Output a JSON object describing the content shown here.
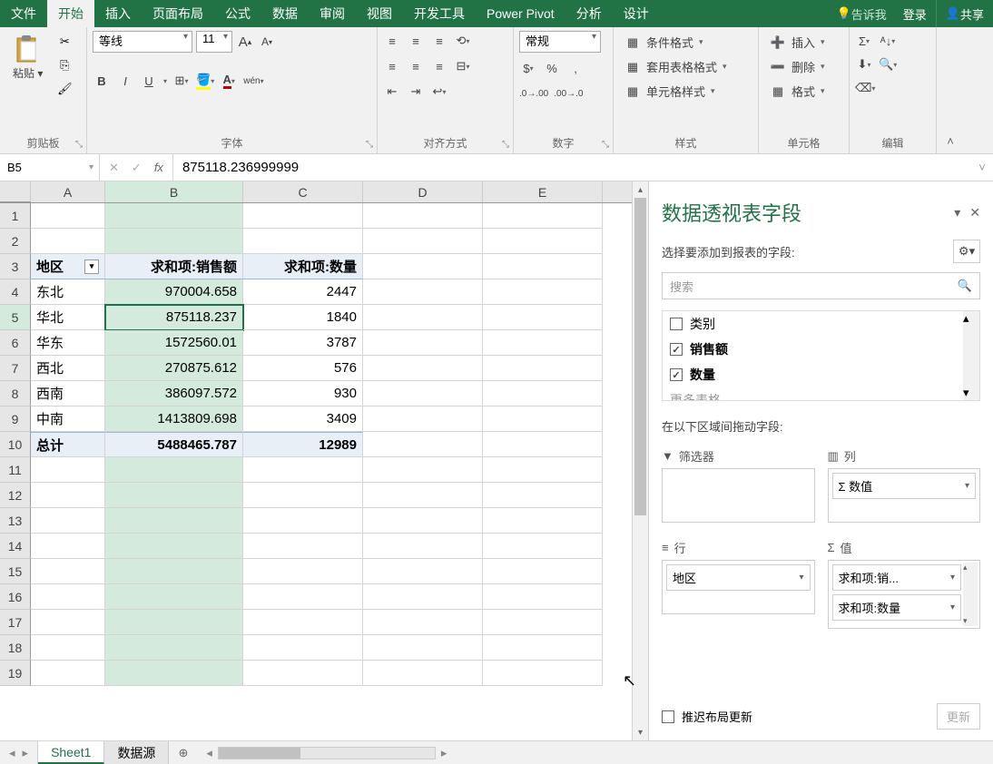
{
  "tabs": {
    "file": "文件",
    "home": "开始",
    "insert": "插入",
    "layout": "页面布局",
    "formulas": "公式",
    "data": "数据",
    "review": "审阅",
    "view": "视图",
    "dev": "开发工具",
    "pivot": "Power Pivot",
    "analyze": "分析",
    "design": "设计",
    "tellme": "告诉我",
    "login": "登录",
    "share": "共享"
  },
  "ribbon": {
    "clipboard": {
      "paste": "粘贴",
      "label": "剪贴板"
    },
    "font": {
      "name": "等线",
      "size": "11",
      "label": "字体",
      "pinyin": "wén"
    },
    "align": {
      "label": "对齐方式"
    },
    "number": {
      "format": "常规",
      "label": "数字"
    },
    "styles": {
      "cond": "条件格式",
      "table": "套用表格格式",
      "cell": "单元格样式",
      "label": "样式"
    },
    "cells": {
      "insert": "插入",
      "delete": "删除",
      "format": "格式",
      "label": "单元格"
    },
    "editing": {
      "label": "编辑"
    }
  },
  "formula_bar": {
    "cell_ref": "B5",
    "value": "875118.236999999"
  },
  "grid": {
    "cols": [
      "A",
      "B",
      "C",
      "D",
      "E"
    ],
    "headers": [
      "地区",
      "求和项:销售额",
      "求和项:数量"
    ],
    "rows": [
      {
        "region": "东北",
        "sales": "970004.658",
        "qty": "2447"
      },
      {
        "region": "华北",
        "sales": "875118.237",
        "qty": "1840"
      },
      {
        "region": "华东",
        "sales": "1572560.01",
        "qty": "3787"
      },
      {
        "region": "西北",
        "sales": "270875.612",
        "qty": "576"
      },
      {
        "region": "西南",
        "sales": "386097.572",
        "qty": "930"
      },
      {
        "region": "中南",
        "sales": "1413809.698",
        "qty": "3409"
      }
    ],
    "total": {
      "label": "总计",
      "sales": "5488465.787",
      "qty": "12989"
    }
  },
  "pane": {
    "title": "数据透视表字段",
    "subtitle": "选择要添加到报表的字段:",
    "search_ph": "搜索",
    "fields": {
      "cat": "类别",
      "sales": "销售额",
      "qty": "数量",
      "more": "更多表格"
    },
    "drag_label": "在以下区域间拖动字段:",
    "zones": {
      "filter": "筛选器",
      "columns": "列",
      "rows": "行",
      "values": "值"
    },
    "chips": {
      "sigma": "Σ 数值",
      "region": "地区",
      "sales": "求和项:销...",
      "qty": "求和项:数量"
    },
    "defer": "推迟布局更新",
    "update": "更新"
  },
  "sheets": {
    "s1": "Sheet1",
    "s2": "数据源"
  }
}
